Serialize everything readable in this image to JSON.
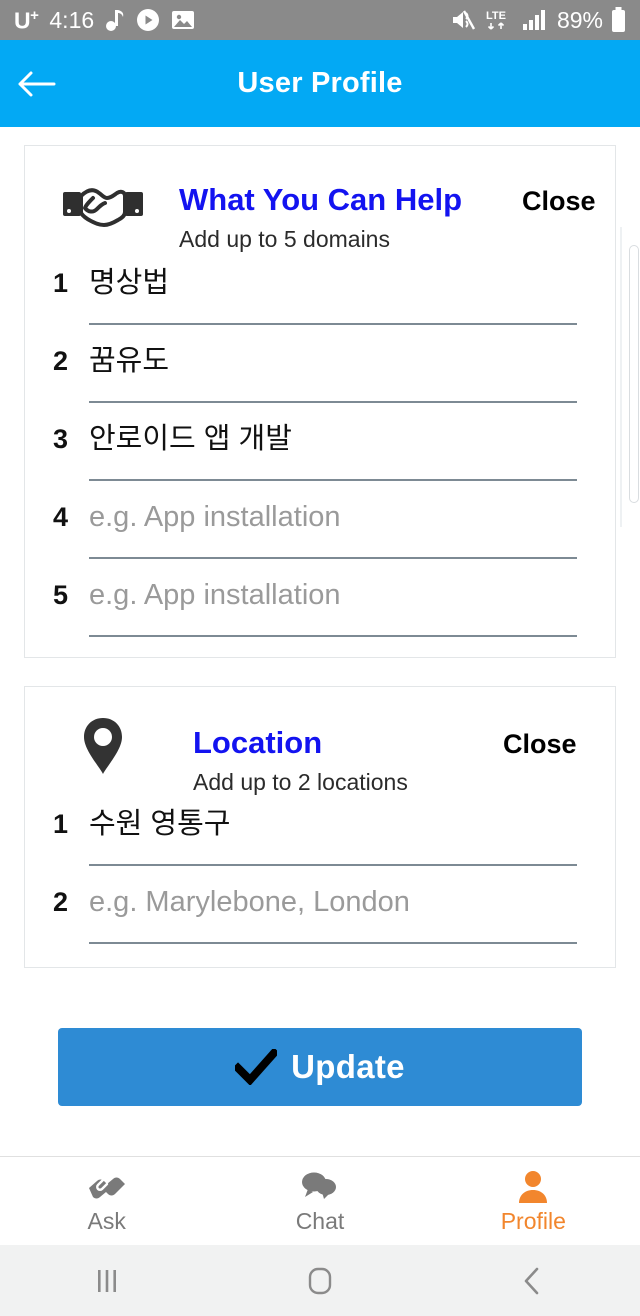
{
  "status_bar": {
    "carrier": "U",
    "carrier_sup": "+",
    "time": "4:16",
    "battery_percent": "89%",
    "network": "LTE",
    "icons_left": [
      "music-note-icon",
      "play-circle-icon",
      "image-icon"
    ],
    "icons_right": [
      "mute-vibrate-icon",
      "lte-data-icon",
      "signal-bars-icon",
      "battery-icon"
    ]
  },
  "app_bar": {
    "title": "User Profile",
    "back_icon": "back-arrow-icon",
    "background_color": "#03A9F4"
  },
  "cards": [
    {
      "id": "domains",
      "icon": "handshake-icon",
      "title": "What You Can Help",
      "title_color": "#1313F0",
      "close_label": "Close",
      "subtitle": "Add up to 5 domains",
      "rows": [
        {
          "num": "1",
          "value": "명상법",
          "placeholder": "e.g. App installation",
          "filled": true
        },
        {
          "num": "2",
          "value": "꿈유도",
          "placeholder": "e.g. App installation",
          "filled": true
        },
        {
          "num": "3",
          "value": "안로이드 앱 개발",
          "placeholder": "e.g. App installation",
          "filled": true
        },
        {
          "num": "4",
          "value": "e.g. App installation",
          "placeholder": "e.g. App installation",
          "filled": false
        },
        {
          "num": "5",
          "value": "e.g. App installation",
          "placeholder": "e.g. App installation",
          "filled": false
        }
      ]
    },
    {
      "id": "locations",
      "icon": "map-pin-icon",
      "title": "Location",
      "title_color": "#1313F0",
      "close_label": "Close",
      "subtitle": "Add up to 2 locations",
      "rows": [
        {
          "num": "1",
          "value": "수원 영통구",
          "placeholder": "e.g. Marylebone, London",
          "filled": true
        },
        {
          "num": "2",
          "value": "e.g. Marylebone, London",
          "placeholder": "e.g. Marylebone, London",
          "filled": false
        }
      ]
    }
  ],
  "update_button": {
    "label": "Update",
    "icon": "check-icon",
    "background_color": "#2E8BD4"
  },
  "bottom_nav": {
    "active": "Profile",
    "active_color": "#F2862D",
    "items": [
      {
        "label": "Ask",
        "icon": "handshake-icon"
      },
      {
        "label": "Chat",
        "icon": "chat-bubbles-icon"
      },
      {
        "label": "Profile",
        "icon": "person-icon"
      }
    ]
  },
  "android_nav": {
    "items": [
      {
        "icon": "recents-icon"
      },
      {
        "icon": "home-icon"
      },
      {
        "icon": "back-icon"
      }
    ]
  }
}
